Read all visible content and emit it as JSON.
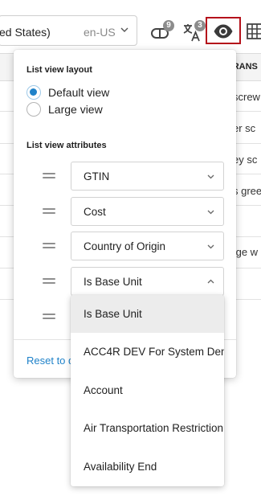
{
  "toolbar": {
    "locale_name": "ed States)",
    "locale_code": "en-US",
    "pill_badge": "9",
    "translate_badge": "3"
  },
  "grid": {
    "column_header": "TRANS",
    "cells": [
      "screw",
      "er sc",
      "ey sc",
      "s gree",
      "fge  w"
    ]
  },
  "panel": {
    "layout_title": "List view layout",
    "layout_options": [
      {
        "label": "Default view",
        "selected": true
      },
      {
        "label": "Large view",
        "selected": false
      }
    ],
    "attributes_title": "List view attributes",
    "attributes": [
      {
        "label": "GTIN",
        "open": false
      },
      {
        "label": "Cost",
        "open": false
      },
      {
        "label": "Country of Origin",
        "open": false
      },
      {
        "label": "Is Base Unit",
        "open": true
      }
    ],
    "reset_label": "Reset to d"
  },
  "menu": {
    "options": [
      {
        "label": "Is Base Unit",
        "active": true
      },
      {
        "label": "ACC4R DEV For System Dem",
        "active": false
      },
      {
        "label": "Account",
        "active": false
      },
      {
        "label": "Air Transportation Restriction",
        "active": false
      },
      {
        "label": "Availability End",
        "active": false
      }
    ]
  },
  "colors": {
    "accent": "#1f82c9",
    "highlight_border": "#b5121b",
    "badge": "#8c8c8c"
  },
  "icons": {
    "pill": "pill-icon",
    "translate": "translate-icon",
    "eye": "eye-icon",
    "grid": "grid-icon",
    "chevron": "chevron-down-icon",
    "drag": "drag-handle-icon"
  }
}
